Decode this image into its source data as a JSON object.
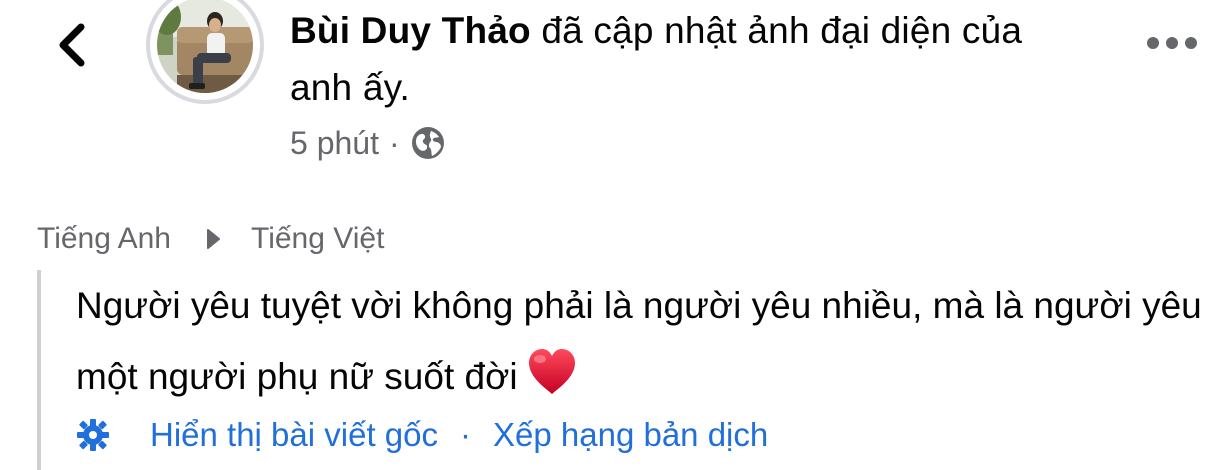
{
  "post": {
    "author": "Bùi Duy Thảo",
    "action_text": " đã cập nhật ảnh đại diện của anh ấy.",
    "time": "5 phút",
    "separator": "·",
    "privacy_icon": "globe-icon"
  },
  "translation": {
    "from_lang": "Tiếng Anh",
    "to_lang": "Tiếng Việt",
    "text": "Người yêu tuyệt vời không phải là người yêu nhiều, mà là người yêu một người phụ nữ suốt đời",
    "emoji": "heart-emoji"
  },
  "links": {
    "show_original": "Hiển thị bài viết gốc",
    "separator": "·",
    "rate_translation": "Xếp hạng bản dịch"
  },
  "icons": {
    "back": "chevron-left-icon",
    "more": "more-horizontal-icon",
    "language_arrow": "play-arrow-icon",
    "settings": "gear-icon"
  },
  "colors": {
    "text": "#050505",
    "secondary_text": "#65676b",
    "link": "#216fdb",
    "heart": "#e0112b",
    "quote_bar": "#ced0d4"
  }
}
